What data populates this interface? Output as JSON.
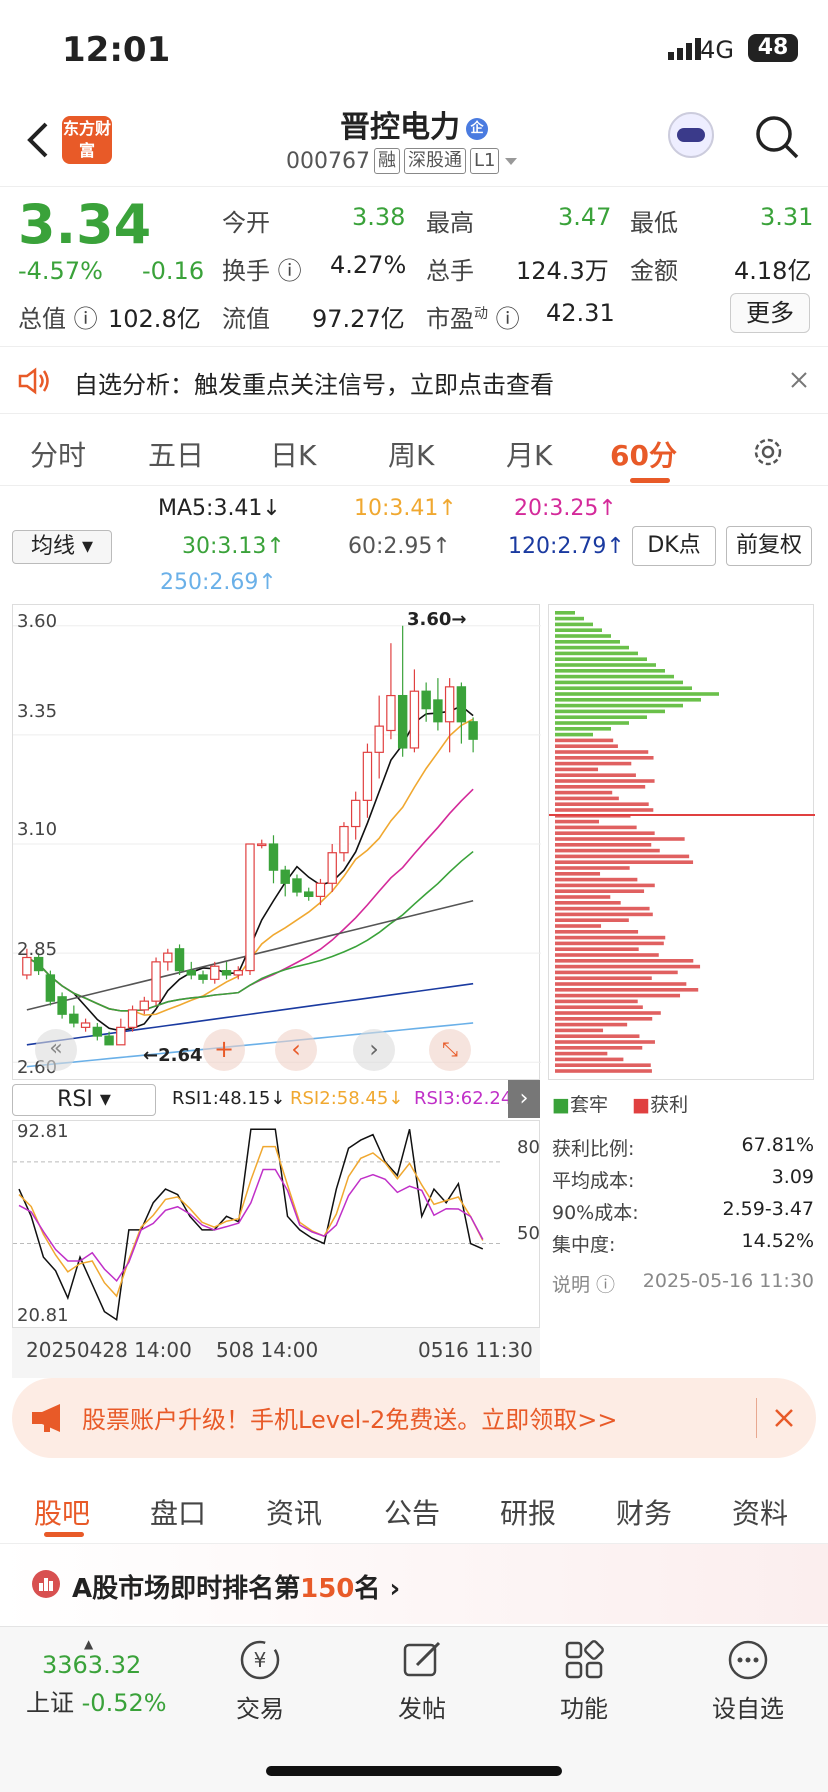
{
  "status": {
    "time": "12:01",
    "network": "4G",
    "battery": "48"
  },
  "header": {
    "logo": "东方财富",
    "title": "晋控电力",
    "badge": "企",
    "code": "000767",
    "tags": [
      "融",
      "深股通",
      "L1"
    ]
  },
  "quote": {
    "price": "3.34",
    "change_pct": "-4.57%",
    "change": "-0.16",
    "open_label": "今开",
    "open": "3.38",
    "high_label": "最高",
    "high": "3.47",
    "low_label": "最低",
    "low": "3.31",
    "turnover_label": "换手",
    "turnover": "4.27%",
    "volume_label": "总手",
    "volume": "124.3万",
    "amount_label": "金额",
    "amount": "4.18亿",
    "mcap_label": "总值",
    "mcap": "102.8亿",
    "float_label": "流值",
    "float": "97.27亿",
    "pe_label": "市盈",
    "pe_sup": "动",
    "pe": "42.31",
    "more": "更多"
  },
  "notice": {
    "text": "自选分析：触发重点关注信号，立即点击查看"
  },
  "period_tabs": [
    "分时",
    "五日",
    "日K",
    "周K",
    "月K",
    "60分"
  ],
  "ma": {
    "selector": "均线",
    "ma5": "MA5:3.41↓",
    "ma10": "10:3.41↑",
    "ma20": "20:3.25↑",
    "ma30": "30:3.13↑",
    "ma60": "60:2.95↑",
    "ma120": "120:2.79↑",
    "ma250": "250:2.69↑",
    "dk": "DK点",
    "fq": "前复权"
  },
  "chart_data": [
    {
      "type": "candlestick",
      "y_ticks": [
        "3.60",
        "3.35",
        "3.10",
        "2.85",
        "2.60"
      ],
      "ylim": [
        2.58,
        3.62
      ],
      "max_label": "3.60",
      "min_label": "2.64",
      "candles": [
        [
          2.8,
          2.84,
          2.86,
          2.79
        ],
        [
          2.84,
          2.81,
          2.85,
          2.8
        ],
        [
          2.8,
          2.74,
          2.81,
          2.73
        ],
        [
          2.75,
          2.71,
          2.76,
          2.7
        ],
        [
          2.71,
          2.69,
          2.73,
          2.68
        ],
        [
          2.68,
          2.69,
          2.7,
          2.67
        ],
        [
          2.68,
          2.66,
          2.69,
          2.65
        ],
        [
          2.66,
          2.64,
          2.67,
          2.64
        ],
        [
          2.64,
          2.68,
          2.7,
          2.64
        ],
        [
          2.68,
          2.72,
          2.73,
          2.67
        ],
        [
          2.72,
          2.74,
          2.75,
          2.71
        ],
        [
          2.74,
          2.83,
          2.84,
          2.73
        ],
        [
          2.83,
          2.85,
          2.86,
          2.81
        ],
        [
          2.86,
          2.81,
          2.87,
          2.8
        ],
        [
          2.81,
          2.8,
          2.83,
          2.79
        ],
        [
          2.8,
          2.79,
          2.81,
          2.78
        ],
        [
          2.79,
          2.82,
          2.83,
          2.78
        ],
        [
          2.81,
          2.8,
          2.83,
          2.79
        ],
        [
          2.8,
          2.81,
          2.82,
          2.79
        ],
        [
          2.81,
          3.1,
          3.1,
          2.8
        ],
        [
          3.1,
          3.1,
          3.11,
          3.09
        ],
        [
          3.1,
          3.04,
          3.12,
          3.01
        ],
        [
          3.04,
          3.01,
          3.05,
          2.98
        ],
        [
          3.02,
          2.99,
          3.03,
          2.98
        ],
        [
          2.99,
          2.98,
          3.0,
          2.97
        ],
        [
          2.98,
          3.01,
          3.02,
          2.96
        ],
        [
          3.01,
          3.08,
          3.1,
          2.99
        ],
        [
          3.08,
          3.14,
          3.15,
          3.06
        ],
        [
          3.14,
          3.2,
          3.22,
          3.11
        ],
        [
          3.2,
          3.31,
          3.33,
          3.16
        ],
        [
          3.31,
          3.37,
          3.44,
          3.25
        ],
        [
          3.36,
          3.44,
          3.56,
          3.34
        ],
        [
          3.44,
          3.32,
          3.6,
          3.3
        ],
        [
          3.32,
          3.45,
          3.5,
          3.31
        ],
        [
          3.45,
          3.41,
          3.47,
          3.38
        ],
        [
          3.43,
          3.38,
          3.48,
          3.36
        ],
        [
          3.38,
          3.46,
          3.48,
          3.31
        ],
        [
          3.46,
          3.38,
          3.47,
          3.33
        ],
        [
          3.38,
          3.34,
          3.39,
          3.31
        ]
      ],
      "series": [
        {
          "name": "MA5"
        },
        {
          "name": "MA10"
        },
        {
          "name": "MA20"
        },
        {
          "name": "MA30"
        },
        {
          "name": "MA60"
        },
        {
          "name": "MA120"
        },
        {
          "name": "MA250"
        }
      ]
    },
    {
      "type": "bar",
      "name": "chip_distribution",
      "legend": [
        "套牢",
        "获利"
      ]
    },
    {
      "type": "line",
      "name": "RSI",
      "ylim": [
        20.81,
        92.81
      ],
      "series": [
        {
          "name": "RSI1",
          "value": "48.15"
        },
        {
          "name": "RSI2",
          "value": "58.45"
        },
        {
          "name": "RSI3",
          "value": "62.24"
        }
      ]
    }
  ],
  "rsi": {
    "selector": "RSI",
    "rsi1": "RSI1:48.15↓",
    "rsi2": "RSI2:58.45↓",
    "rsi3": "RSI3:62.24",
    "top": "92.81",
    "bottom": "20.81",
    "l80": "80",
    "l50": "50"
  },
  "xaxis": {
    "t1": "20250428 14:00",
    "t2": "508 14:00",
    "t3": "0516 11:30"
  },
  "chip": {
    "legend_trapped": "套牢",
    "legend_profit": "获利",
    "profit_ratio_label": "获利比例:",
    "profit_ratio": "67.81%",
    "avg_cost_label": "平均成本:",
    "avg_cost": "3.09",
    "cost90_label": "90%成本:",
    "cost90": "2.59-3.47",
    "concentration_label": "集中度:",
    "concentration": "14.52%",
    "note_label": "说明",
    "note_time": "2025-05-16 11:30"
  },
  "promo": {
    "text": "股票账户升级！手机Level-2免费送。立即领取>>"
  },
  "bottom_tabs": [
    "股吧",
    "盘口",
    "资讯",
    "公告",
    "研报",
    "财务",
    "资料"
  ],
  "rank": {
    "prefix": "A股市场即时排名第",
    "num": "150",
    "suffix": "名"
  },
  "nav": {
    "index_val": "3363.32",
    "index_name": "上证",
    "index_chg": "-0.52%",
    "trade": "交易",
    "post": "发帖",
    "func": "功能",
    "watch": "设自选"
  },
  "colors": {
    "up": "#e04040",
    "down": "#3aa23a",
    "accent": "#e85a28"
  }
}
